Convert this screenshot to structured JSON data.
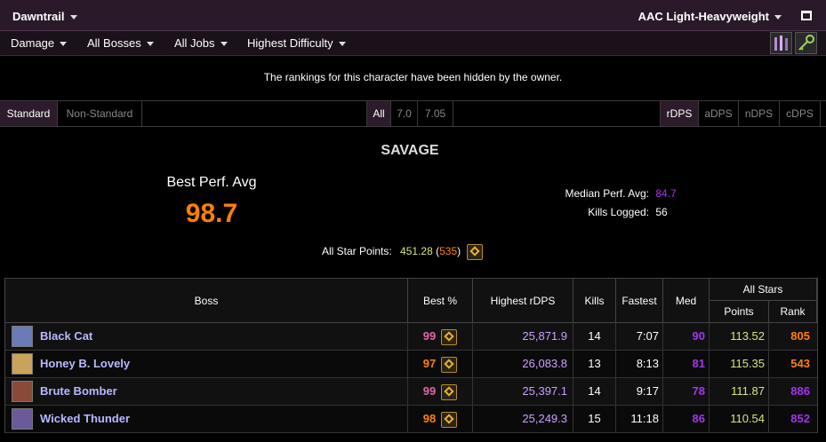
{
  "topbar": {
    "zone": "Dawntrail",
    "partition": "AAC Light-Heavyweight"
  },
  "filters": [
    {
      "label": "Damage"
    },
    {
      "label": "All Bosses"
    },
    {
      "label": "All Jobs"
    },
    {
      "label": "Highest Difficulty"
    }
  ],
  "notice": "The rankings for this character have been hidden by the owner.",
  "tabs": {
    "standard": "Standard",
    "nonstandard": "Non-Standard",
    "all": "All",
    "v70": "7.0",
    "v705": "7.05",
    "rdps": "rDPS",
    "adps": "aDPS",
    "ndps": "nDPS",
    "cdps": "cDPS"
  },
  "summary": {
    "heading": "SAVAGE",
    "best_perf_label": "Best Perf. Avg",
    "best_perf_value": "98.7",
    "median_label": "Median Perf. Avg:",
    "median_value": "84.7",
    "kills_label": "Kills Logged:",
    "kills_value": "56",
    "allstar_label": "All Star Points:",
    "allstar_points": "451.28",
    "allstar_rank": "535"
  },
  "table": {
    "headers": {
      "boss": "Boss",
      "best": "Best %",
      "highest": "Highest rDPS",
      "kills": "Kills",
      "fastest": "Fastest",
      "med": "Med",
      "allstars": "All Stars",
      "points": "Points",
      "rank": "Rank"
    },
    "rows": [
      {
        "boss": "Black Cat",
        "best": "99",
        "highest": "25,871.9",
        "kills": "14",
        "fastest": "7:07",
        "med": "90",
        "points": "113.52",
        "rank": "805",
        "best_color": "#e268a8",
        "med_color": "#a335ee",
        "rank_color": "#ff8000",
        "portrait_color": "#6a7bb5"
      },
      {
        "boss": "Honey B. Lovely",
        "best": "97",
        "highest": "26,083.8",
        "kills": "13",
        "fastest": "8:13",
        "med": "81",
        "points": "115.35",
        "rank": "543",
        "best_color": "#ff8000",
        "med_color": "#a335ee",
        "rank_color": "#ff8000",
        "portrait_color": "#c9a35a"
      },
      {
        "boss": "Brute Bomber",
        "best": "99",
        "highest": "25,397.1",
        "kills": "14",
        "fastest": "9:17",
        "med": "78",
        "points": "111.87",
        "rank": "886",
        "best_color": "#e268a8",
        "med_color": "#a335ee",
        "rank_color": "#a335ee",
        "portrait_color": "#8a4a3a"
      },
      {
        "boss": "Wicked Thunder",
        "best": "98",
        "highest": "25,249.3",
        "kills": "15",
        "fastest": "11:18",
        "med": "86",
        "points": "110.54",
        "rank": "852",
        "best_color": "#ff8000",
        "med_color": "#a335ee",
        "rank_color": "#a335ee",
        "portrait_color": "#6a5a9a"
      }
    ]
  }
}
